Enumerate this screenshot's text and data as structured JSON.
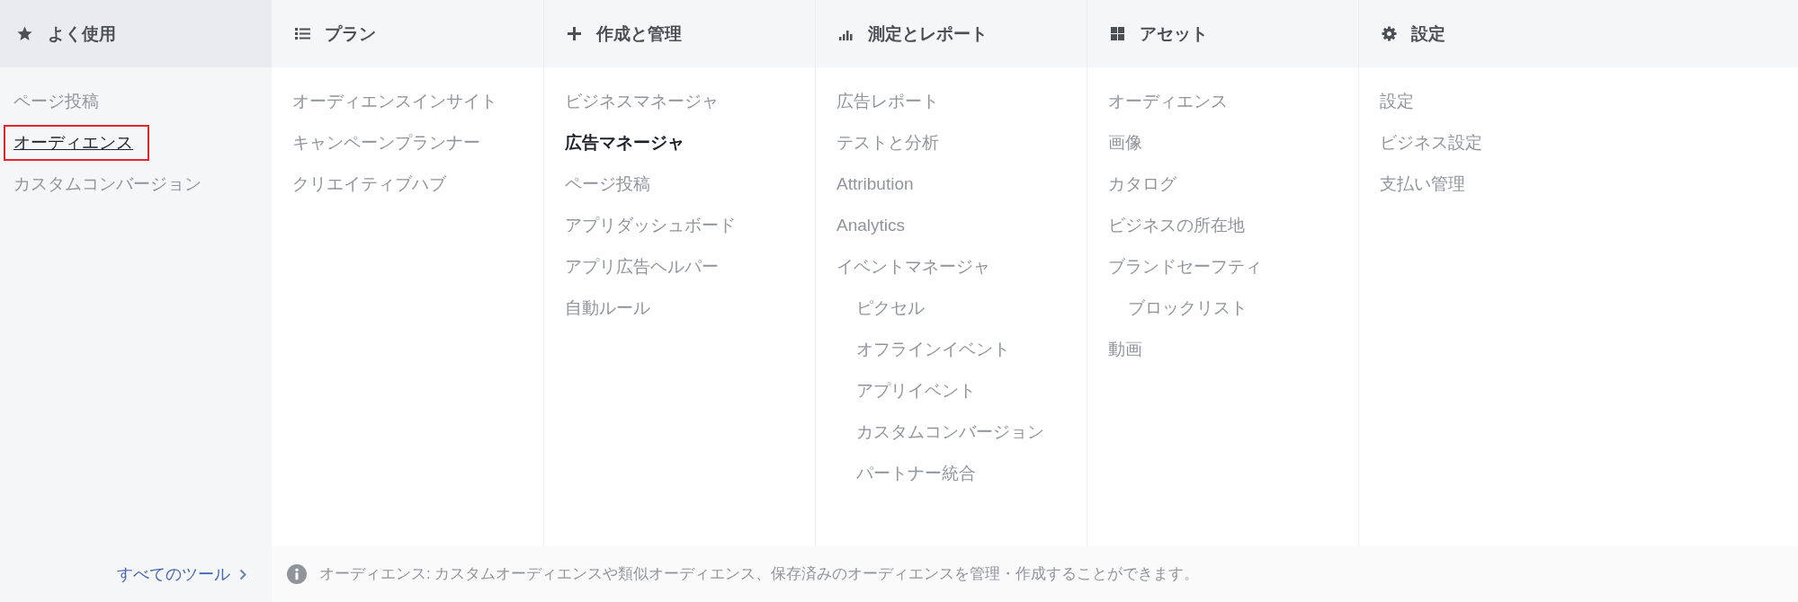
{
  "shortcuts": {
    "title": "よく使用",
    "selected": true,
    "items": [
      {
        "label": "ページ投稿",
        "selected": false,
        "highlighted": false
      },
      {
        "label": "オーディエンス",
        "selected": false,
        "highlighted": true
      },
      {
        "label": "カスタムコンバージョン",
        "selected": false,
        "highlighted": false
      }
    ],
    "all_tools_link": "すべてのツール"
  },
  "columns": [
    {
      "title": "プラン",
      "selected": false,
      "items": [
        {
          "label": "オーディエンスインサイト",
          "selected": false,
          "highlighted": false
        },
        {
          "label": "キャンペーンプランナー",
          "selected": false,
          "highlighted": false
        },
        {
          "label": "クリエイティブハブ",
          "selected": false,
          "highlighted": false
        }
      ]
    },
    {
      "title": "作成と管理",
      "selected": false,
      "items": [
        {
          "label": "ビジネスマネージャ",
          "selected": false,
          "highlighted": false
        },
        {
          "label": "広告マネージャ",
          "selected": true,
          "highlighted": false
        },
        {
          "label": "ページ投稿",
          "selected": false,
          "highlighted": false
        },
        {
          "label": "アプリダッシュボード",
          "selected": false,
          "highlighted": false
        },
        {
          "label": "アプリ広告ヘルパー",
          "selected": false,
          "highlighted": false
        },
        {
          "label": "自動ルール",
          "selected": false,
          "highlighted": false
        }
      ]
    },
    {
      "title": "測定とレポート",
      "selected": false,
      "items": [
        {
          "label": "広告レポート",
          "selected": false,
          "highlighted": false
        },
        {
          "label": "テストと分析",
          "selected": false,
          "highlighted": false
        },
        {
          "label": "Attribution",
          "selected": false,
          "highlighted": false
        },
        {
          "label": "Analytics",
          "selected": false,
          "highlighted": false
        },
        {
          "label": "イベントマネージャ",
          "selected": false,
          "highlighted": false,
          "children": [
            {
              "label": "ピクセル",
              "selected": false,
              "highlighted": false
            },
            {
              "label": "オフラインイベント",
              "selected": false,
              "highlighted": false
            },
            {
              "label": "アプリイベント",
              "selected": false,
              "highlighted": false
            },
            {
              "label": "カスタムコンバージョン",
              "selected": false,
              "highlighted": false
            },
            {
              "label": "パートナー統合",
              "selected": false,
              "highlighted": false
            }
          ]
        }
      ]
    },
    {
      "title": "アセット",
      "selected": false,
      "items": [
        {
          "label": "オーディエンス",
          "selected": false,
          "highlighted": false
        },
        {
          "label": "画像",
          "selected": false,
          "highlighted": false
        },
        {
          "label": "カタログ",
          "selected": false,
          "highlighted": false
        },
        {
          "label": "ビジネスの所在地",
          "selected": false,
          "highlighted": false
        },
        {
          "label": "ブランドセーフティ",
          "selected": false,
          "highlighted": false,
          "children": [
            {
              "label": "ブロックリスト",
              "selected": false,
              "highlighted": false
            }
          ]
        },
        {
          "label": "動画",
          "selected": false,
          "highlighted": false
        }
      ]
    },
    {
      "title": "設定",
      "selected": false,
      "items": [
        {
          "label": "設定",
          "selected": false,
          "highlighted": false
        },
        {
          "label": "ビジネス設定",
          "selected": false,
          "highlighted": false
        },
        {
          "label": "支払い管理",
          "selected": false,
          "highlighted": false
        }
      ]
    }
  ],
  "footer": {
    "info": "オーディエンス: カスタムオーディエンスや類似オーディエンス、保存済みのオーディエンスを管理・作成することができます。"
  }
}
